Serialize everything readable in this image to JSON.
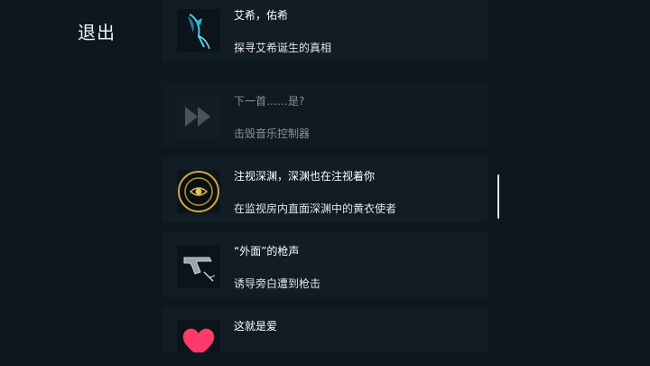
{
  "exit_label": "退出",
  "achievements": [
    {
      "title": "艾希，佑希",
      "description": "探寻艾希诞生的真相",
      "icon": "cyan-scythe-icon",
      "locked": false
    },
    {
      "title": "下一首……是?",
      "description": "击毁音乐控制器",
      "icon": "fast-forward-icon",
      "locked": true
    },
    {
      "title": "注视深渊，深渊也在注视着你",
      "description": "在监视房内直面深渊中的黄衣使者",
      "icon": "golden-eye-icon",
      "locked": false
    },
    {
      "title": "“外面”的枪声",
      "description": "诱导旁白遭到枪击",
      "icon": "pistol-icon",
      "locked": false
    },
    {
      "title": "这就是爱",
      "description": "",
      "icon": "heart-icon",
      "locked": false
    }
  ],
  "colors": {
    "background": "#0c1720",
    "card": "#111c25",
    "accent_cyan": "#3fd4e6",
    "accent_gold": "#c9a844",
    "heart": "#ff3a6a"
  }
}
